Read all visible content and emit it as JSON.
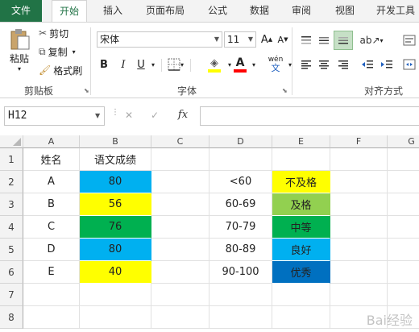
{
  "ribbon_tabs": [
    {
      "label": "文件"
    },
    {
      "label": "开始"
    },
    {
      "label": "插入"
    },
    {
      "label": "页面布局"
    },
    {
      "label": "公式"
    },
    {
      "label": "数据"
    },
    {
      "label": "审阅"
    },
    {
      "label": "视图"
    },
    {
      "label": "开发工具"
    }
  ],
  "clipboard": {
    "paste_label": "粘贴",
    "cut_label": "剪切",
    "copy_label": "复制",
    "format_painter_label": "格式刷",
    "group_label": "剪贴板"
  },
  "font": {
    "font_name": "宋体",
    "font_size": "11",
    "bold_label": "B",
    "italic_label": "I",
    "underline_label": "U",
    "grow_label": "A",
    "shrink_label": "A",
    "font_color_label": "A",
    "wen_label": "wén",
    "wen_sub": "文",
    "group_label": "字体",
    "fill_color": "#ffff00",
    "font_color": "#ff0000"
  },
  "alignment": {
    "group_label": "对齐方式"
  },
  "formula_bar": {
    "name_box": "H12",
    "cancel_symbol": "✕",
    "enter_symbol": "✓",
    "fx_label": "fx",
    "formula_value": ""
  },
  "sheet": {
    "columns": [
      "A",
      "B",
      "C",
      "D",
      "E",
      "F",
      "G"
    ],
    "rows": [
      "1",
      "2",
      "3",
      "4",
      "5",
      "6",
      "7",
      "8"
    ],
    "cells": {
      "A1": "姓名",
      "B1": "语文成绩",
      "A2": "A",
      "B2": "80",
      "D2": "<60",
      "E2": "不及格",
      "A3": "B",
      "B3": "56",
      "D3": "60-69",
      "E3": "及格",
      "A4": "C",
      "B4": "76",
      "D4": "70-79",
      "E4": "中等",
      "A5": "D",
      "B5": "80",
      "D5": "80-89",
      "E5": "良好",
      "A6": "E",
      "B6": "40",
      "D6": "90-100",
      "E6": "优秀"
    },
    "fills": {
      "B2": "#00b0f0",
      "B3": "#ffff00",
      "B4": "#00b050",
      "B5": "#00b0f0",
      "B6": "#ffff00",
      "E2": "#ffff00",
      "E3": "#92d050",
      "E4": "#00b050",
      "E5": "#00b0f0",
      "E6": "#0070c0"
    }
  },
  "watermark": "Bai经验"
}
